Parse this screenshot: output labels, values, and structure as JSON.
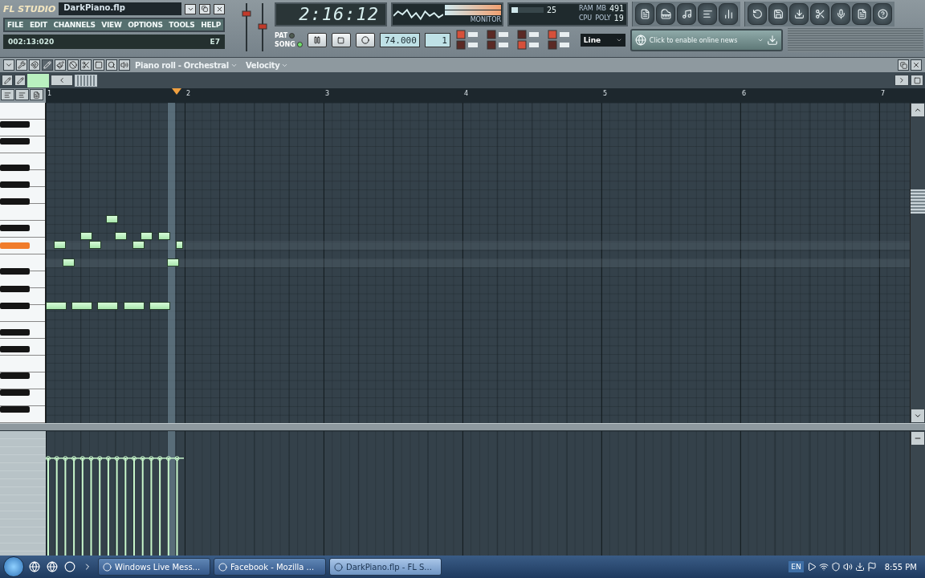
{
  "app": {
    "logo": "FL STUDIO",
    "project_title": "DarkPiano.flp",
    "menu": [
      "FILE",
      "EDIT",
      "CHANNELS",
      "VIEW",
      "OPTIONS",
      "TOOLS",
      "HELP"
    ],
    "hint_time": "002:13:020",
    "hint_note": "E7"
  },
  "transport": {
    "song_time": "2:16:12",
    "modes": [
      {
        "label": "PAT",
        "selected": false
      },
      {
        "label": "SONG",
        "selected": true
      }
    ],
    "tempo": "74.000",
    "pattern": "1"
  },
  "monitor": {
    "cpu": "25",
    "cpu_meter": {
      "level": 0.2
    },
    "ram": "491",
    "ram_label": "RAM",
    "mb_label": "MB",
    "cpu_label": "CPU",
    "poly_label": "POLY",
    "poly": "19",
    "monitor_label": "MONITOR"
  },
  "snap": {
    "value": "Line"
  },
  "news": {
    "text": "Click to enable online news"
  },
  "piano_roll": {
    "title": "Piano roll - Orchestral",
    "target": "Velocity",
    "ruler": [
      "1",
      "2",
      "3",
      "4",
      "5",
      "6",
      "7"
    ]
  },
  "taskbar": {
    "tasks": [
      {
        "label": "Windows Live Mess...",
        "selected": false
      },
      {
        "label": "Facebook - Mozilla ...",
        "selected": false
      },
      {
        "label": "DarkPiano.flp - FL S...",
        "selected": true
      }
    ],
    "language": "EN",
    "clock": "8:55 PM"
  }
}
